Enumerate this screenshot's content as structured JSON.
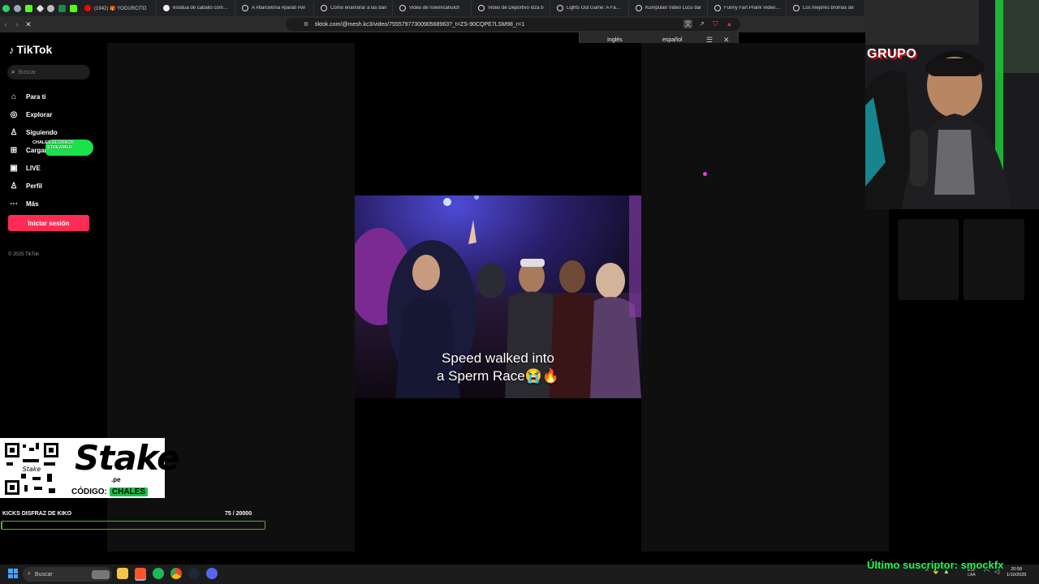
{
  "browser": {
    "tabs": [
      {
        "label": "(1942) 🎁 YOGURCITO"
      },
      {
        "label": "estatua de caballo como b"
      },
      {
        "label": "A #barcelona #parati #vir"
      },
      {
        "label": "Cómo enamorar a las ban"
      },
      {
        "label": "Video de noemicahuich"
      },
      {
        "label": "Video de Deportivo loza b"
      },
      {
        "label": "Lights Out Game: A Family"
      },
      {
        "label": "Kumpulan Video Lucu dar"
      },
      {
        "label": "Funny Fart Prank Video Th"
      },
      {
        "label": "Los mejores bromas de"
      }
    ],
    "url": "tiktok.com/@mesh.kc3/video/7555797730090568963?_t=ZS-90CQPE7LSM98_r=1",
    "translate": {
      "tab_source": "Inglés",
      "tab_target": "español"
    }
  },
  "tiktok": {
    "logo": "TikTok",
    "search_placeholder": "Buscar",
    "nav": [
      {
        "label": "Para ti",
        "icon": "home-icon"
      },
      {
        "label": "Explorar",
        "icon": "compass-icon"
      },
      {
        "label": "Siguiendo",
        "icon": "user-follow-icon"
      },
      {
        "label": "Cargar",
        "icon": "upload-icon"
      },
      {
        "label": "LIVE",
        "icon": "live-icon"
      },
      {
        "label": "Perfil",
        "icon": "profile-icon"
      },
      {
        "label": "Más",
        "icon": "more-icon"
      }
    ],
    "login": "Iniciar sesión",
    "copyright": "© 2025 TikTok",
    "video_caption_line1": "Speed walked into",
    "video_caption_line2": "a Sperm Race😭🔥"
  },
  "overlay": {
    "badge_text_line1": "CHALES ELCRACK",
    "badge_text_line2": "STREAMER",
    "cam_banner": "GRUPO",
    "stake": {
      "logo": "Stake",
      "sub": ".pe",
      "code_label": "CÓDIGO:",
      "code": "CHALES"
    },
    "goal": {
      "title": "KICKS DISFRAZ DE KIKO",
      "value": "75 / 20000",
      "progress": 0.00375
    },
    "subscriber": "Último suscriptor: smockfx"
  },
  "taskbar": {
    "search": "Buscar",
    "lang_line1": "ESP",
    "lang_line2": "LAA",
    "time": "20:58",
    "date": "1/10/2025"
  },
  "colors": {
    "tiktok_red": "#fe2c55",
    "goal_green": "#5aa83a",
    "subscriber_green": "#27f05a"
  }
}
